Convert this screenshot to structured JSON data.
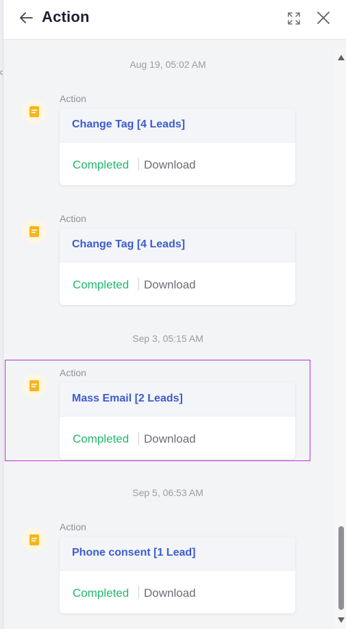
{
  "header": {
    "title": "Action",
    "icons": [
      "back-arrow-icon",
      "expand-icon",
      "close-icon"
    ]
  },
  "colors": {
    "accent_title": "#3c5cd0",
    "status_completed": "#22b86b",
    "icon_amber": "#f6b51c"
  },
  "timeline": {
    "dates": [
      "Aug 19, 05:02 AM",
      "Sep 3, 05:15 AM",
      "Sep 5, 06:53 AM"
    ],
    "entries": [
      {
        "kind": "Action",
        "title": "Change Tag [4 Leads]",
        "status": "Completed",
        "download": "Download"
      },
      {
        "kind": "Action",
        "title": "Change Tag [4 Leads]",
        "status": "Completed",
        "download": "Download"
      },
      {
        "kind": "Action",
        "title": "Mass Email [2 Leads]",
        "status": "Completed",
        "download": "Download"
      },
      {
        "kind": "Action",
        "title": "Phone consent [1 Lead]",
        "status": "Completed",
        "download": "Download"
      }
    ]
  }
}
